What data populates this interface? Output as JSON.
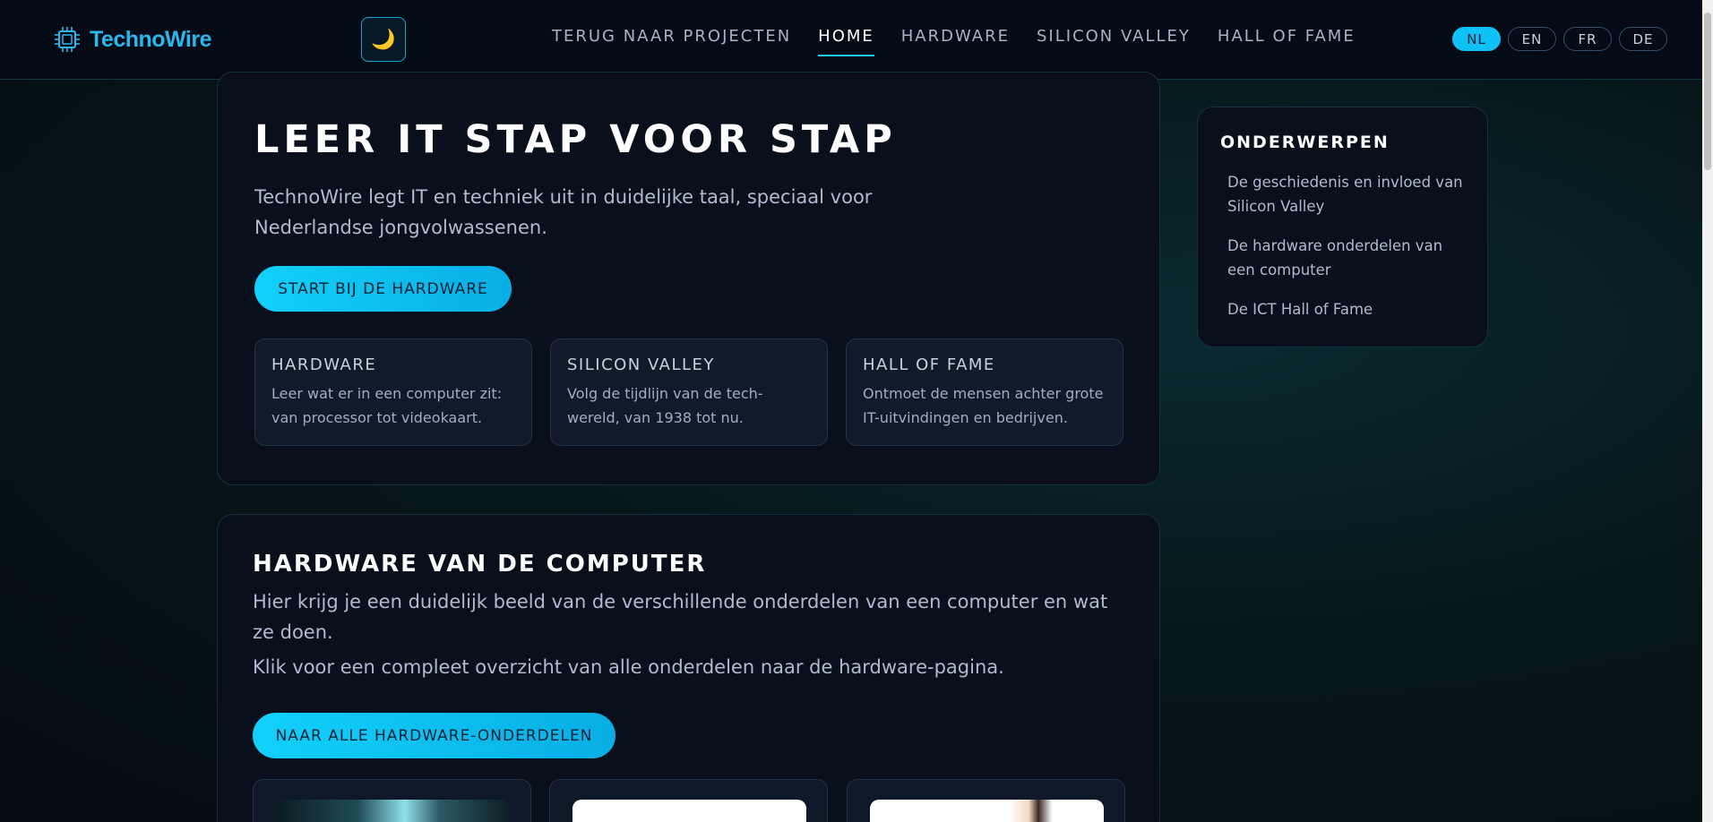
{
  "header": {
    "logo_text": "TechnoWire",
    "theme_icon": "🌙",
    "nav": [
      {
        "label": "TERUG NAAR PROJECTEN"
      },
      {
        "label": "HOME"
      },
      {
        "label": "HARDWARE"
      },
      {
        "label": "SILICON VALLEY"
      },
      {
        "label": "HALL OF FAME"
      }
    ],
    "active_nav": "HOME",
    "languages": [
      "NL",
      "EN",
      "FR",
      "DE"
    ],
    "active_language": "NL"
  },
  "hero": {
    "title": "LEER IT STAP VOOR STAP",
    "lead": "TechnoWire legt IT en techniek uit in duidelijke taal, speciaal voor Nederlandse jongvolwassenen.",
    "cta": "START BIJ DE HARDWARE",
    "cards": [
      {
        "title": "HARDWARE",
        "text": "Leer wat er in een computer zit: van processor tot videokaart."
      },
      {
        "title": "SILICON VALLEY",
        "text": "Volg de tijdlijn van de tech-wereld, van 1938 tot nu."
      },
      {
        "title": "HALL OF FAME",
        "text": "Ontmoet de mensen achter grote IT-uitvindingen en bedrijven."
      }
    ]
  },
  "sidebar": {
    "title": "ONDERWERPEN",
    "items": [
      {
        "label": "De geschiedenis en invloed van Silicon Valley"
      },
      {
        "label": "De hardware onderdelen van een computer"
      },
      {
        "label": "De ICT Hall of Fame"
      }
    ]
  },
  "hardware": {
    "title": "HARDWARE VAN DE COMPUTER",
    "p1": "Hier krijg je een duidelijk beeld van de verschillende onderdelen van een computer en wat ze doen.",
    "p2": "Klik voor een compleet overzicht van alle onderdelen naar de hardware-pagina.",
    "cta": "NAAR ALLE HARDWARE-ONDERDELEN"
  },
  "colors": {
    "accent": "#12d0fb",
    "logo": "#2ab8ec",
    "card_bg": "#0a0f1c",
    "header_bg": "#050b16"
  }
}
